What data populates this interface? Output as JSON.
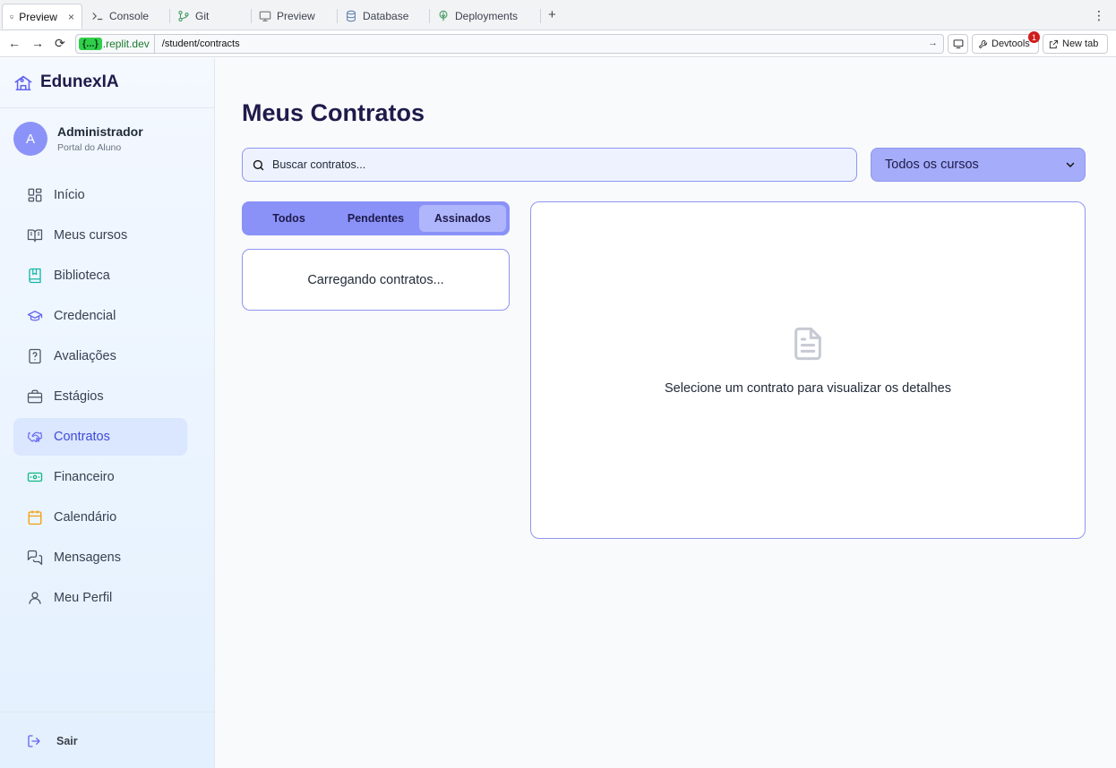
{
  "browser": {
    "tabs": [
      {
        "label": "Preview",
        "icon": "monitor-icon",
        "active": true
      },
      {
        "label": "Console",
        "icon": "terminal-icon"
      },
      {
        "label": "Git",
        "icon": "git-icon"
      },
      {
        "label": "Preview",
        "icon": "monitor-icon"
      },
      {
        "label": "Database",
        "icon": "database-icon"
      },
      {
        "label": "Deployments",
        "icon": "deployments-icon"
      }
    ],
    "close_symbol": "×",
    "new_tab_symbol": "+",
    "menu_symbol": "⋮",
    "url_chip": "{...}",
    "url_domain": ".replit.dev",
    "url_path": "/student/contracts",
    "devtools_label": "Devtools",
    "devtools_badge": "1",
    "newtab_label": "New tab"
  },
  "sidebar": {
    "brand": "EdunexIA",
    "user": {
      "initial": "A",
      "name": "Administrador",
      "role": "Portal do Aluno"
    },
    "items": [
      {
        "label": "Início",
        "icon": "grid-icon",
        "color": "#4b5563"
      },
      {
        "label": "Meus cursos",
        "icon": "book-open-icon",
        "color": "#4b5563"
      },
      {
        "label": "Biblioteca",
        "icon": "library-icon",
        "color": "#14b8a6"
      },
      {
        "label": "Credencial",
        "icon": "graduation-cap-icon",
        "color": "#6366f1"
      },
      {
        "label": "Avaliações",
        "icon": "question-file-icon",
        "color": "#4b5563"
      },
      {
        "label": "Estágios",
        "icon": "briefcase-icon",
        "color": "#4b5563"
      },
      {
        "label": "Contratos",
        "icon": "handshake-icon",
        "color": "#6366f1",
        "active": true
      },
      {
        "label": "Financeiro",
        "icon": "banknote-icon",
        "color": "#10b981"
      },
      {
        "label": "Calendário",
        "icon": "calendar-icon",
        "color": "#f59e0b"
      },
      {
        "label": "Mensagens",
        "icon": "messages-icon",
        "color": "#4b5563"
      },
      {
        "label": "Meu Perfil",
        "icon": "user-icon",
        "color": "#4b5563"
      }
    ],
    "logout": "Sair"
  },
  "main": {
    "title": "Meus Contratos",
    "search_placeholder": "Buscar contratos...",
    "course_filter": {
      "selected": "Todos os cursos"
    },
    "tabs": [
      {
        "label": "Todos"
      },
      {
        "label": "Pendentes"
      },
      {
        "label": "Assinados",
        "active": true
      }
    ],
    "loading_text": "Carregando contratos...",
    "empty_detail_text": "Selecione um contrato para visualizar os detalhes"
  },
  "colors": {
    "accent": "#8a92f8",
    "title": "#1e1b4b",
    "active_nav_bg": "#dbe6ff"
  }
}
